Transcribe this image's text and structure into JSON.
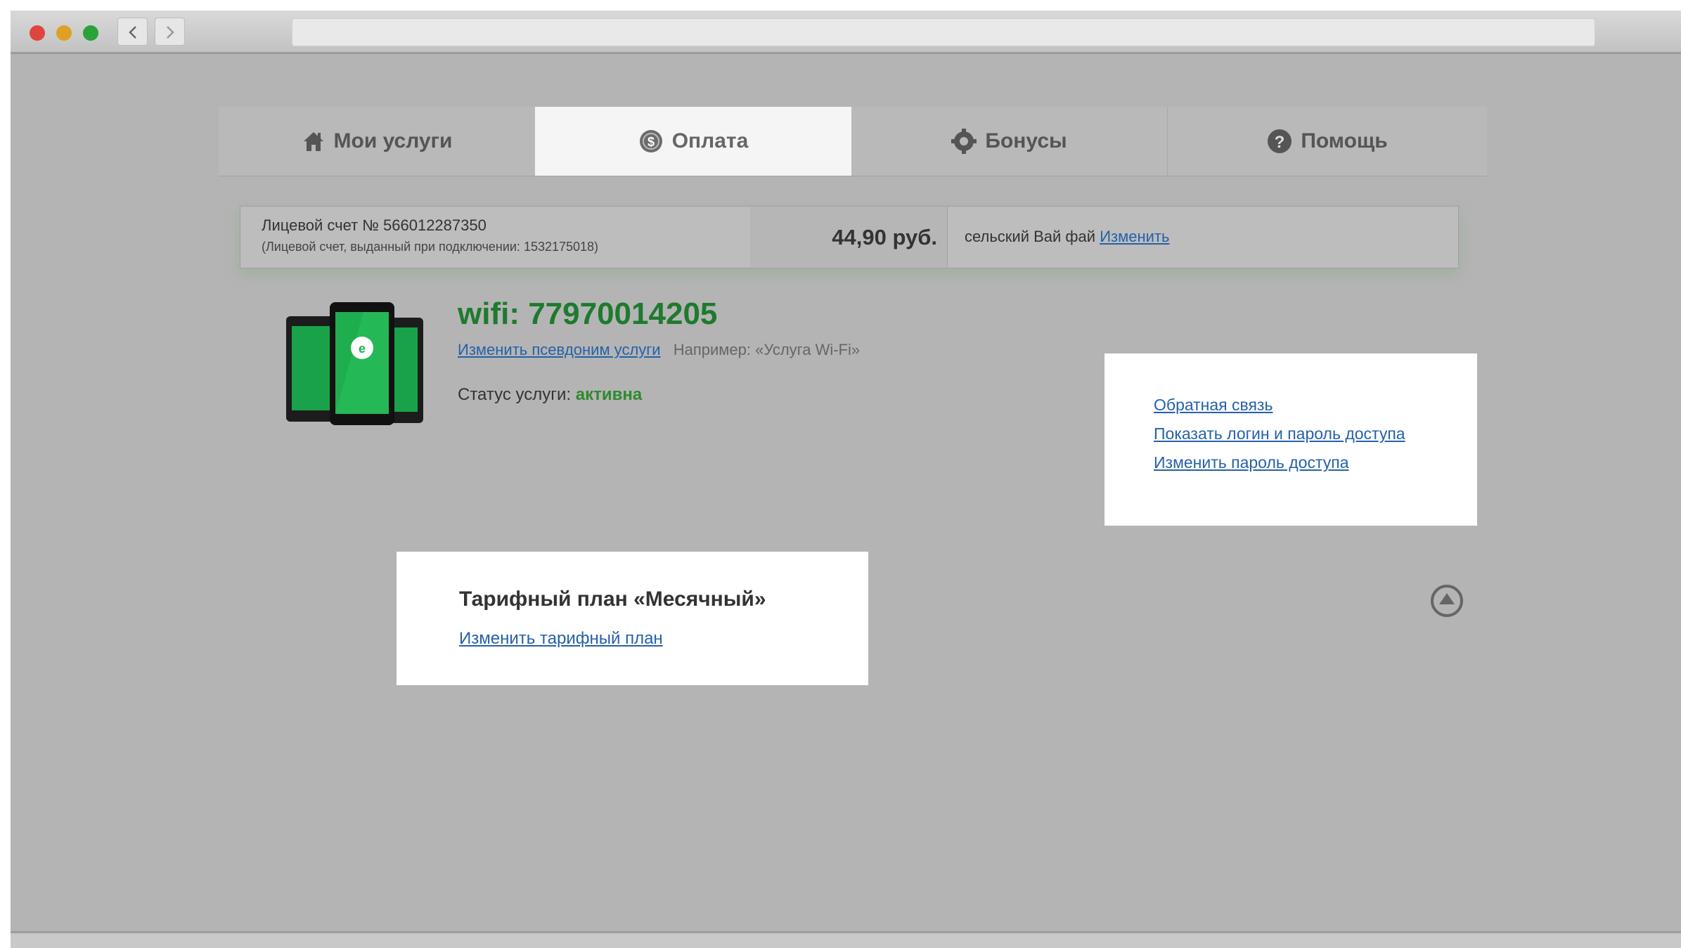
{
  "tabs": [
    {
      "label": "Мои услуги",
      "icon": "home-icon"
    },
    {
      "label": "Оплата",
      "icon": "payment-icon"
    },
    {
      "label": "Бонусы",
      "icon": "gear-icon"
    },
    {
      "label": "Помощь",
      "icon": "help-icon"
    }
  ],
  "account": {
    "number_label": "Лицевой счет № 566012287350",
    "issued_label": "(Лицевой счет, выданный при подключении: 1532175018)",
    "balance": "44,90 руб.",
    "name": "сельский Вай фай",
    "change_link": "Изменить"
  },
  "service": {
    "title": "wifi: 77970014205",
    "alias_link": "Изменить псевдоним услуги",
    "alias_hint": "Например: «Услуга Wi-Fi»",
    "status_label": "Статус услуги:",
    "status_value": "активна"
  },
  "links": {
    "feedback": "Обратная связь",
    "show_credentials": "Показать логин и пароль доступа",
    "change_password": "Изменить пароль доступа"
  },
  "tariff": {
    "title": "Тарифный план «Месячный»",
    "change_link": "Изменить тарифный план"
  },
  "colors": {
    "accent_green": "#1e7a2e",
    "link_blue": "#2561a8",
    "background": "#b4b4b4"
  }
}
